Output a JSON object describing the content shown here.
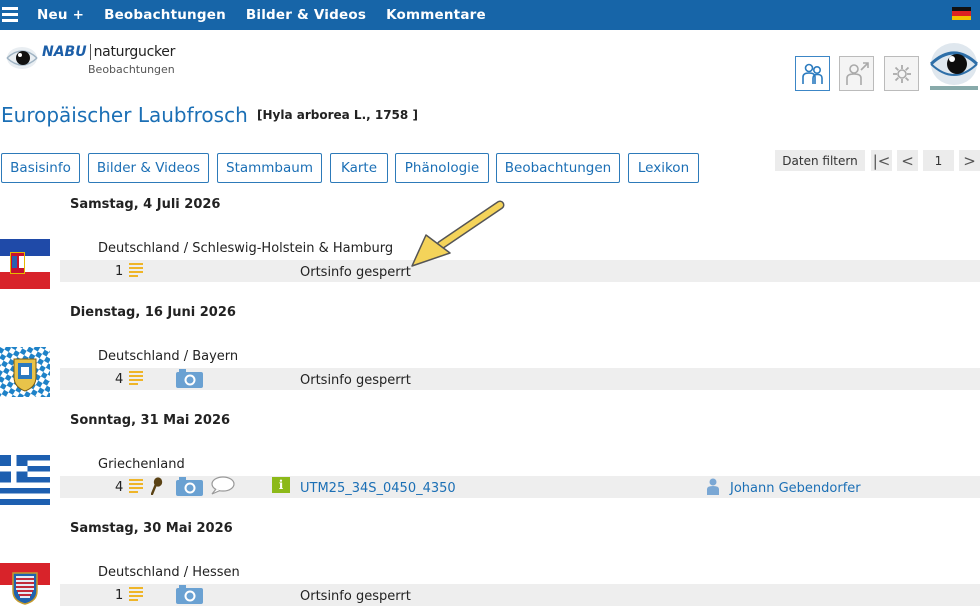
{
  "nav": {
    "items": [
      "Neu +",
      "Beobachtungen",
      "Bilder & Videos",
      "Kommentare"
    ]
  },
  "logo": {
    "brand": "NABU",
    "product": "naturgucker",
    "subtitle": "Beobachtungen"
  },
  "species": {
    "name": "Europäischer Laubfrosch",
    "latin": "[Hyla arborea L., 1758 ]"
  },
  "tabs": [
    "Basisinfo",
    "Bilder & Videos",
    "Stammbaum",
    "Karte",
    "Phänologie",
    "Beobachtungen",
    "Lexikon"
  ],
  "filter": {
    "label": "Daten filtern",
    "first": "|<",
    "prev": "<",
    "page": "1",
    "next": ">"
  },
  "observations": [
    {
      "date": "Samstag, 4 Juli 2026",
      "location": "Deutschland / Schleswig-Holstein & Hamburg",
      "flag": "schleswig-holstein-hamburg",
      "count": "1",
      "has_photo": false,
      "place": "Ortsinfo gesperrt"
    },
    {
      "date": "Dienstag, 16 Juni 2026",
      "location": "Deutschland / Bayern",
      "flag": "bayern",
      "count": "4",
      "has_photo": true,
      "place": "Ortsinfo gesperrt"
    },
    {
      "date": "Sonntag, 31 Mai 2026",
      "location": "Griechenland",
      "flag": "greece",
      "count": "4",
      "has_photo": true,
      "has_comment": true,
      "has_magnifier": true,
      "has_info": true,
      "place": "UTM25_34S_0450_4350",
      "observer": "Johann Gebendorfer"
    },
    {
      "date": "Samstag, 30 Mai 2026",
      "location": "Deutschland / Hessen",
      "flag": "hessen",
      "count": "1",
      "has_photo": true,
      "place": "Ortsinfo gesperrt"
    }
  ],
  "icons": {
    "menu": "hamburger-icon",
    "language": "german-flag-icon",
    "list": "list-icon",
    "camera": "camera-icon",
    "comment": "speech-bubble-icon",
    "magnifier": "magnifier-icon",
    "info": "info-icon",
    "person": "person-icon"
  },
  "colors": {
    "topbar": "#1765a8",
    "link": "#1b6fb5",
    "list_icon": "#efb528",
    "camera": "#6aa1d2",
    "info": "#8cb919",
    "annotation_arrow": "#f4d35a"
  }
}
